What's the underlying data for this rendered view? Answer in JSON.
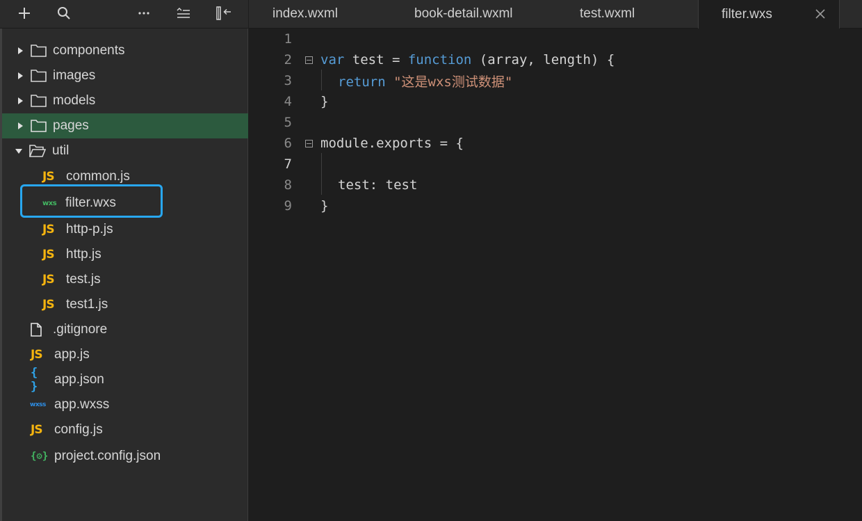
{
  "toolbar": {
    "add_icon": "plus-icon",
    "search_icon": "search-icon",
    "more_icon": "ellipsis-icon",
    "outline_icon": "collapse-list-icon",
    "layout_icon": "panel-collapse-icon"
  },
  "tree": {
    "items": [
      {
        "label": "components",
        "type": "folder",
        "expanded": false
      },
      {
        "label": "images",
        "type": "folder",
        "expanded": false
      },
      {
        "label": "models",
        "type": "folder",
        "expanded": false
      },
      {
        "label": "pages",
        "type": "folder",
        "expanded": false,
        "selected": true
      },
      {
        "label": "util",
        "type": "folder",
        "expanded": true
      },
      {
        "label": "common.js",
        "type": "js"
      },
      {
        "label": "filter.wxs",
        "type": "wxs",
        "highlighted": true
      },
      {
        "label": "http-p.js",
        "type": "js"
      },
      {
        "label": "http.js",
        "type": "js"
      },
      {
        "label": "test.js",
        "type": "js"
      },
      {
        "label": "test1.js",
        "type": "js"
      },
      {
        "label": ".gitignore",
        "type": "file"
      },
      {
        "label": "app.js",
        "type": "js"
      },
      {
        "label": "app.json",
        "type": "json"
      },
      {
        "label": "app.wxss",
        "type": "wxss"
      },
      {
        "label": "config.js",
        "type": "js"
      },
      {
        "label": "project.config.json",
        "type": "config"
      }
    ],
    "icon_text": {
      "js": "JS",
      "wxs": "wxs",
      "wxss": "wxss",
      "json": "{ }",
      "config": "{⚙}"
    }
  },
  "tabs": [
    {
      "label": "index.wxml"
    },
    {
      "label": "book-detail.wxml"
    },
    {
      "label": "test.wxml"
    },
    {
      "label": "filter.wxs",
      "active": true
    }
  ],
  "editor": {
    "line_numbers": [
      "1",
      "2",
      "3",
      "4",
      "5",
      "6",
      "7",
      "8",
      "9"
    ],
    "current_line": "7",
    "lines": {
      "l2_kw": "var",
      "l2_a": " test = ",
      "l2_fn": "function",
      "l2_b": " (array, length) {",
      "l3_kw": "return",
      "l3_str": "\"这是wxs测试数据\"",
      "l4": "}",
      "l6": "module.exports = {",
      "l8": "test: test",
      "l9": "}"
    }
  },
  "colors": {
    "selected_row": "#2c5a3e",
    "highlight_border": "#28a7f0",
    "keyword": "#569cd6",
    "string": "#ce9178",
    "js_icon": "#f5b40f"
  }
}
